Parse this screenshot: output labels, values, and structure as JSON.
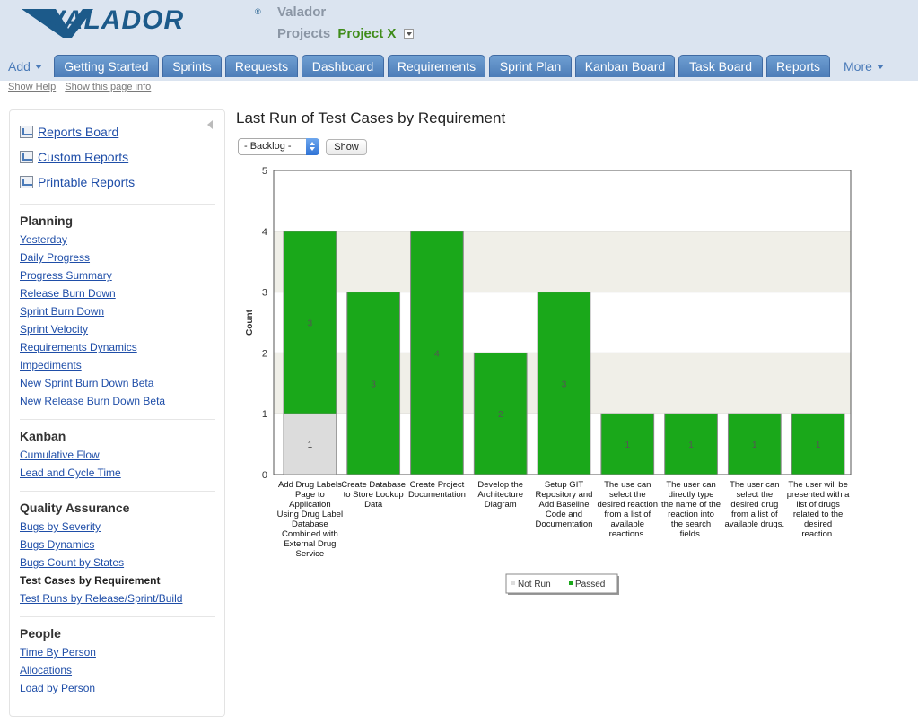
{
  "header": {
    "logo_text": "VALADOR",
    "company": "Valador",
    "projects_label": "Projects",
    "project_name": "Project X"
  },
  "nav": {
    "add_label": "Add",
    "tabs": [
      "Getting Started",
      "Sprints",
      "Requests",
      "Dashboard",
      "Requirements",
      "Sprint Plan",
      "Kanban Board",
      "Task Board",
      "Reports"
    ],
    "more_label": "More"
  },
  "help": {
    "show_help": "Show Help",
    "show_page_info": "Show this page info"
  },
  "sidebar": {
    "top_links": [
      "Reports Board",
      "Custom Reports",
      "Printable Reports"
    ],
    "sections": [
      {
        "title": "Planning",
        "items": [
          "Yesterday",
          "Daily Progress",
          "Progress Summary",
          "Release Burn Down",
          "Sprint Burn Down",
          "Sprint Velocity",
          "Requirements Dynamics",
          "Impediments",
          "New Sprint Burn Down Beta",
          "New Release Burn Down Beta"
        ]
      },
      {
        "title": "Kanban",
        "items": [
          "Cumulative Flow",
          "Lead and Cycle Time"
        ]
      },
      {
        "title": "Quality Assurance",
        "items": [
          "Bugs by Severity",
          "Bugs Dynamics",
          "Bugs Count by States",
          "Test Cases by Requirement",
          "Test Runs by Release/Sprint/Build"
        ]
      },
      {
        "title": "People",
        "items": [
          "Time By Person",
          "Allocations",
          "Load by Person"
        ]
      }
    ],
    "active_item": "Test Cases by Requirement"
  },
  "main": {
    "title": "Last Run of Test Cases by Requirement",
    "filter_value": "- Backlog -",
    "show_label": "Show"
  },
  "colors": {
    "passed": "#1aa81a",
    "not_run": "#dcdcdc",
    "tab": "#5b8cc6"
  },
  "chart_data": {
    "type": "bar",
    "stacked": true,
    "categories": [
      "Add Drug Labels Page to Application Using Drug Label Database Combined with External Drug Service",
      "Create Database to Store Lookup Data",
      "Create Project Documentation",
      "Develop the Architecture Diagram",
      "Setup GIT Repository and Add Baseline Code and Documentation",
      "The use can select the desired reaction from a list of available reactions.",
      "The user can directly type the name of the reaction into the search fields.",
      "The user can select the desired drug from a list of available drugs.",
      "The user will be presented with a list of drugs related to the desired reaction."
    ],
    "series": [
      {
        "name": "Not Run",
        "color": "#dcdcdc",
        "values": [
          1,
          0,
          0,
          0,
          0,
          0,
          0,
          0,
          0
        ]
      },
      {
        "name": "Passed",
        "color": "#1aa81a",
        "values": [
          3,
          3,
          4,
          2,
          3,
          1,
          1,
          1,
          1
        ]
      }
    ],
    "ylabel": "Count",
    "ylim": [
      0,
      5
    ],
    "yticks": [
      0,
      1,
      2,
      3,
      4,
      5
    ],
    "grid": true,
    "legend_position": "bottom-center"
  }
}
